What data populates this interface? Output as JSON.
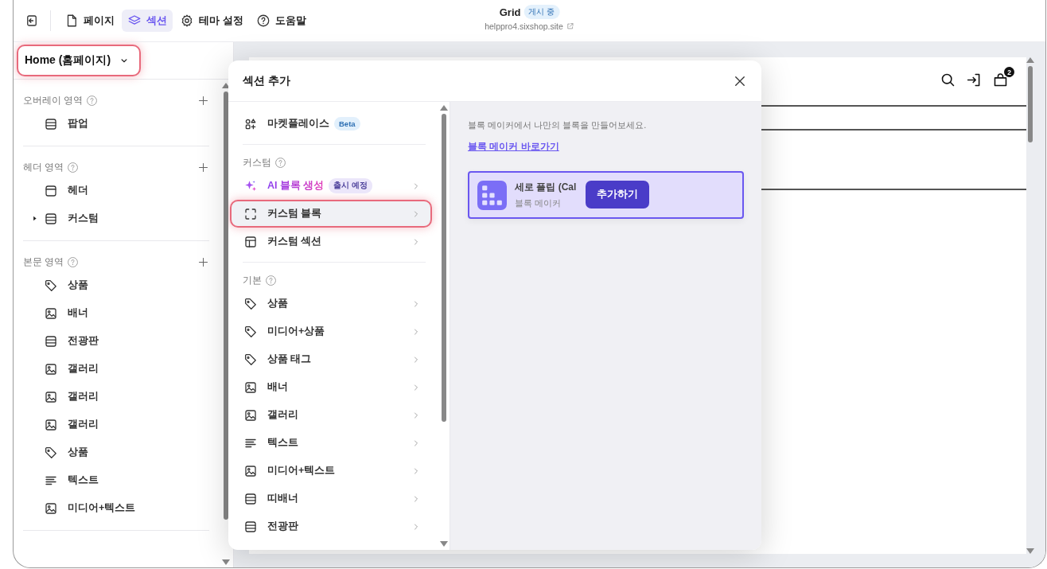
{
  "topbar": {
    "tabs": [
      {
        "kind": "page",
        "label": "페이지",
        "selected": false
      },
      {
        "kind": "layers",
        "label": "섹션",
        "selected": true
      },
      {
        "kind": "gear",
        "label": "테마 설정",
        "selected": false
      },
      {
        "kind": "help",
        "label": "도움말",
        "selected": false
      }
    ],
    "site": {
      "name": "Grid",
      "status": "게시 중",
      "url": "helppro4.sixshop.site"
    }
  },
  "sidebar": {
    "page_select": {
      "label": "Home (홈페이지)",
      "highlighted": true
    },
    "groups": [
      {
        "title": "오버레이 영역",
        "items": [
          {
            "kind": "rows",
            "label": "팝업"
          }
        ]
      },
      {
        "title": "헤더 영역",
        "items": [
          {
            "kind": "header",
            "label": "헤더"
          },
          {
            "kind": "rows",
            "label": "커스텀",
            "expanded": false
          }
        ]
      },
      {
        "title": "본문 영역",
        "items": [
          {
            "kind": "tag",
            "label": "상품"
          },
          {
            "kind": "image",
            "label": "배너"
          },
          {
            "kind": "rows",
            "label": "전광판"
          },
          {
            "kind": "image",
            "label": "갤러리"
          },
          {
            "kind": "image",
            "label": "갤러리"
          },
          {
            "kind": "image",
            "label": "갤러리"
          },
          {
            "kind": "tag",
            "label": "상품"
          },
          {
            "kind": "text",
            "label": "텍스트"
          },
          {
            "kind": "image",
            "label": "미디어+텍스트"
          }
        ]
      }
    ]
  },
  "preview": {
    "cart_count": "2"
  },
  "dialog": {
    "title": "섹션 추가",
    "groups": [
      {
        "items": [
          {
            "kind": "market",
            "label": "마켓플레이스",
            "badge": {
              "text": "Beta",
              "color": "#e2f0fc"
            },
            "submenu": false,
            "selected": false,
            "highlighted": false
          }
        ]
      },
      {
        "title": "커스텀",
        "items": [
          {
            "kind": "ai",
            "label": "AI 블록 생성",
            "badge": {
              "text": "출시 예정",
              "color": "#ebe6fa"
            },
            "submenu": true,
            "selected": false,
            "highlighted": false
          },
          {
            "kind": "frame",
            "label": "커스텀 블록",
            "submenu": true,
            "selected": true,
            "highlighted": true
          },
          {
            "kind": "layout",
            "label": "커스텀 섹션",
            "submenu": true,
            "selected": false,
            "highlighted": false
          }
        ]
      },
      {
        "title": "기본",
        "items": [
          {
            "kind": "tag",
            "label": "상품",
            "submenu": true,
            "selected": false,
            "highlighted": false
          },
          {
            "kind": "tag",
            "label": "미디어+상품",
            "submenu": true,
            "selected": false,
            "highlighted": false
          },
          {
            "kind": "tag",
            "label": "상품 태그",
            "submenu": true,
            "selected": false,
            "highlighted": false
          },
          {
            "kind": "image",
            "label": "배너",
            "submenu": true,
            "selected": false,
            "highlighted": false
          },
          {
            "kind": "image",
            "label": "갤러리",
            "submenu": true,
            "selected": false,
            "highlighted": false
          },
          {
            "kind": "text",
            "label": "텍스트",
            "submenu": true,
            "selected": false,
            "highlighted": false
          },
          {
            "kind": "image",
            "label": "미디어+텍스트",
            "submenu": true,
            "selected": false,
            "highlighted": false
          },
          {
            "kind": "rows",
            "label": "띠배너",
            "submenu": true,
            "selected": false,
            "highlighted": false
          },
          {
            "kind": "rows",
            "label": "전광판",
            "submenu": true,
            "selected": false,
            "highlighted": false
          }
        ]
      }
    ],
    "detail": {
      "hint": "블록 메이커에서 나만의 블록을 만들어보세요.",
      "link": "블록 메이커 바로가기",
      "blocks": [
        {
          "title": "세로 플립 (Cal",
          "subtitle": "블록 메이커",
          "action": "추가하기",
          "selected": true
        }
      ]
    }
  }
}
